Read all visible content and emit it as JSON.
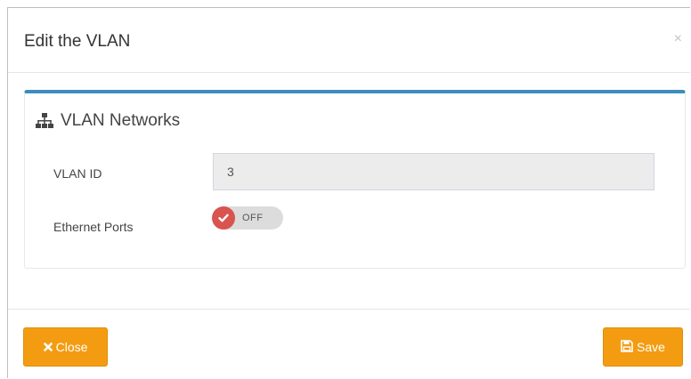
{
  "modal": {
    "title": "Edit the VLAN",
    "close_symbol": "×"
  },
  "panel": {
    "icon": "sitemap-icon",
    "title": "VLAN Networks"
  },
  "form": {
    "vlan_id_label": "VLAN ID",
    "vlan_id_value": "3",
    "ethernet_ports_label": "Ethernet Ports",
    "ethernet_ports_toggle": "OFF"
  },
  "footer": {
    "close_label": "Close",
    "close_icon": "times-icon",
    "save_label": "Save",
    "save_icon": "floppy-disk-icon"
  },
  "colors": {
    "panel_accent": "#3c8dbc",
    "button_bg": "#f39c12",
    "toggle_knob": "#d9534f",
    "input_bg": "#ececec"
  }
}
